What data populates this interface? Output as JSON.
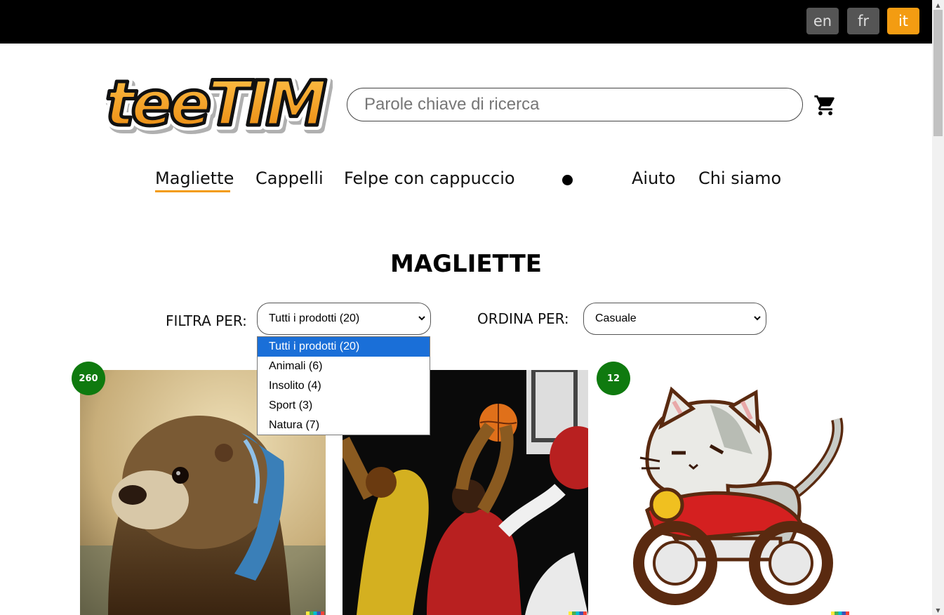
{
  "languages": [
    {
      "code": "en",
      "label": "en",
      "active": false
    },
    {
      "code": "fr",
      "label": "fr",
      "active": false
    },
    {
      "code": "it",
      "label": "it",
      "active": true
    }
  ],
  "header": {
    "logo_text": "teeTIM",
    "search_placeholder": "Parole chiave di ricerca",
    "cart_icon": "cart-icon"
  },
  "nav": {
    "items": [
      "Magliette",
      "Cappelli",
      "Felpe con cappuccio",
      "Aiuto",
      "Chi siamo"
    ],
    "active": "Magliette"
  },
  "page": {
    "title": "MAGLIETTE"
  },
  "filters": {
    "filter_label": "FILTRA PER:",
    "filter_value": "Tutti i prodotti (20)",
    "sort_label": "ORDINA PER:",
    "sort_value": "Casuale",
    "filter_options": [
      "Tutti i prodotti (20)",
      "Animali (6)",
      "Insolito (4)",
      "Sport (3)",
      "Natura (7)"
    ],
    "selected_option": "Tutti i prodotti (20)"
  },
  "products": [
    {
      "badge": "260",
      "image": "otter-painting"
    },
    {
      "badge": "",
      "image": "basketball-painting"
    },
    {
      "badge": "12",
      "image": "cat-motorcycle"
    }
  ],
  "colors": {
    "accent": "#f39c12",
    "badge": "#0f7a0f",
    "option_highlight": "#1a6fd8"
  }
}
